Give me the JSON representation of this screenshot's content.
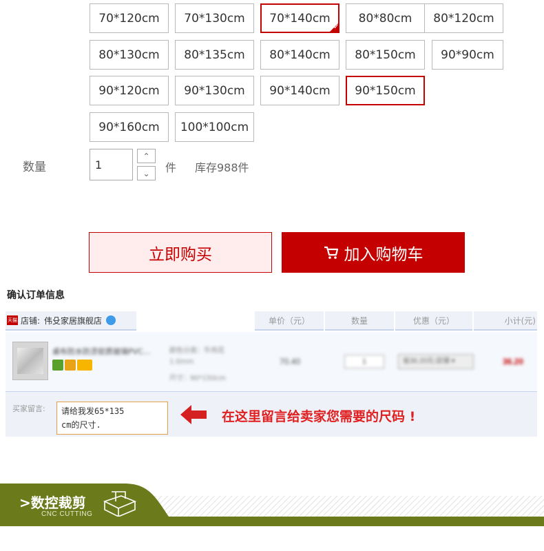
{
  "sizes": [
    [
      "70*120cm",
      "70*130cm",
      "70*140cm",
      "80*80cm",
      "80*120cm"
    ],
    [
      "80*130cm",
      "80*135cm",
      "80*140cm",
      "80*150cm",
      "90*90cm"
    ],
    [
      "90*120cm",
      "90*130cm",
      "90*140cm",
      "90*150cm"
    ],
    [
      "90*160cm",
      "100*100cm"
    ]
  ],
  "selected_size_checked": "70*140cm",
  "selected_size_hover": "90*150cm",
  "quantity": {
    "label": "数量",
    "value": "1",
    "unit": "件",
    "stock": "库存988件"
  },
  "buttons": {
    "buy_now": "立即购买",
    "add_to_cart": "加入购物车"
  },
  "order": {
    "title": "确认订单信息",
    "store_badge": "天猫",
    "store_label": "店铺:",
    "store_name": "伟殳家居旗舰店",
    "columns": [
      "单价（元）",
      "数量",
      "优惠（元）",
      "小计(元)"
    ],
    "item_title": "桌布防水防烫软质玻璃PVC...",
    "item_props": [
      "颜色分类：牛肉花",
      "1.0mm",
      "尺寸：90*150cm"
    ],
    "item_price": "70.40",
    "item_qty": "1",
    "item_discount": "省36.20元:店铺 ▾",
    "item_subtotal": "36.20"
  },
  "message": {
    "label": "买家留言:",
    "text": "请给我发65*135\ncm的尺寸.",
    "hint": "在这里留言给卖家您需要的尺码 !"
  },
  "banner": {
    "title": ">数控裁剪",
    "subtitle": "CNC CUTTING"
  },
  "colors": {
    "accent_red": "#c40000",
    "banner_olive": "#6b7a1a"
  }
}
